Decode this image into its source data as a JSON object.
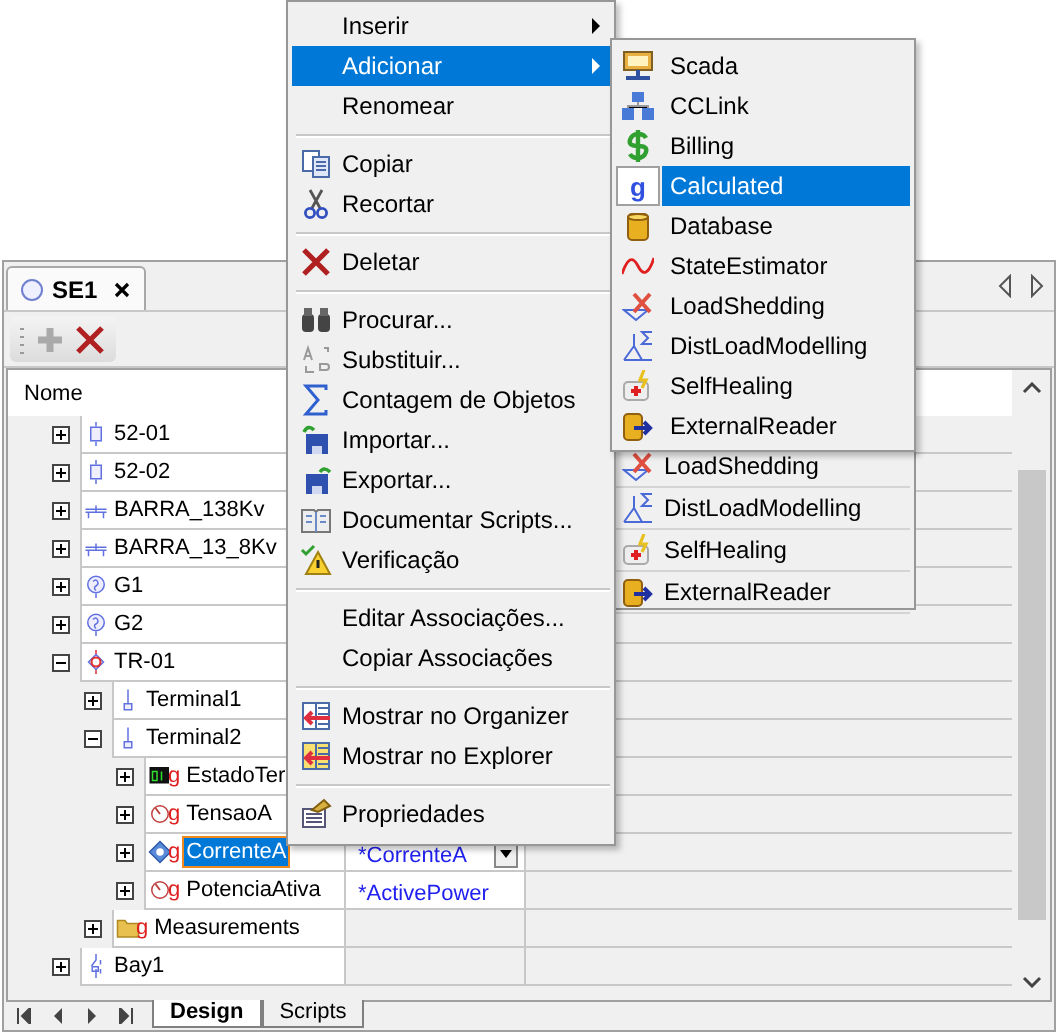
{
  "document_tab": {
    "label": "SE1",
    "selected": true
  },
  "tree": {
    "column_header": "Nome",
    "rows": [
      {
        "label": "52-01",
        "kind": "breaker",
        "expanded": false,
        "selected": false
      },
      {
        "label": "52-02",
        "kind": "breaker",
        "expanded": false,
        "selected": false
      },
      {
        "label": "BARRA_138Kv",
        "kind": "bus",
        "expanded": false,
        "selected": false
      },
      {
        "label": "BARRA_13_8Kv",
        "kind": "bus",
        "expanded": false,
        "selected": false
      },
      {
        "label": "G1",
        "kind": "generator",
        "expanded": false,
        "selected": false
      },
      {
        "label": "G2",
        "kind": "generator",
        "expanded": false,
        "selected": false
      },
      {
        "label": "TR-01",
        "kind": "transformer",
        "expanded": true,
        "selected": false,
        "children": [
          {
            "label": "Terminal1",
            "kind": "terminal",
            "expanded": false,
            "selected": false
          },
          {
            "label": "Terminal2",
            "kind": "terminal",
            "expanded": true,
            "selected": false,
            "children": [
              {
                "label": "EstadoTer",
                "kind": "digital",
                "badge": "g",
                "expanded": false,
                "selected": false
              },
              {
                "label": "TensaoA",
                "kind": "analog",
                "badge": "g",
                "expanded": false,
                "selected": false
              },
              {
                "label": "CorrenteA",
                "kind": "analog-set",
                "badge": "g",
                "expanded": false,
                "selected": true,
                "value": "*CorrenteA",
                "value_dropdown": true
              },
              {
                "label": "PotenciaAtiva",
                "kind": "analog",
                "badge": "g",
                "expanded": false,
                "selected": false,
                "value": "*ActivePower"
              }
            ]
          },
          {
            "label": "Measurements",
            "kind": "folder",
            "badge": "g",
            "expanded": false,
            "selected": false
          }
        ]
      },
      {
        "label": "Bay1",
        "kind": "bay",
        "expanded": false,
        "selected": false
      }
    ]
  },
  "sheet_tabs": [
    {
      "label": "Design",
      "selected": true
    },
    {
      "label": "Scripts",
      "selected": false
    }
  ],
  "context_menu": {
    "groups": [
      [
        {
          "label": "Inserir",
          "kind": "none",
          "submenu": true,
          "selected": false
        },
        {
          "label": "Adicionar",
          "kind": "none",
          "submenu": true,
          "selected": true
        },
        {
          "label": "Renomear",
          "kind": "none",
          "submenu": false,
          "selected": false
        }
      ],
      [
        {
          "label": "Copiar",
          "kind": "copy",
          "submenu": false,
          "selected": false
        },
        {
          "label": "Recortar",
          "kind": "cut",
          "submenu": false,
          "selected": false
        }
      ],
      [
        {
          "label": "Deletar",
          "kind": "delete",
          "submenu": false,
          "selected": false
        }
      ],
      [
        {
          "label": "Procurar...",
          "kind": "find",
          "submenu": false,
          "selected": false
        },
        {
          "label": "Substituir...",
          "kind": "replace",
          "submenu": false,
          "selected": false
        },
        {
          "label": "Contagem de Objetos",
          "kind": "sum",
          "submenu": false,
          "selected": false
        },
        {
          "label": "Importar...",
          "kind": "import",
          "submenu": false,
          "selected": false
        },
        {
          "label": "Exportar...",
          "kind": "export",
          "submenu": false,
          "selected": false
        },
        {
          "label": "Documentar Scripts...",
          "kind": "book",
          "submenu": false,
          "selected": false
        },
        {
          "label": "Verificação",
          "kind": "warning",
          "submenu": false,
          "selected": false
        }
      ],
      [
        {
          "label": "Editar Associações...",
          "kind": "none",
          "submenu": false,
          "selected": false
        },
        {
          "label": "Copiar Associações",
          "kind": "none",
          "submenu": false,
          "selected": false
        }
      ],
      [
        {
          "label": "Mostrar no Organizer",
          "kind": "show",
          "submenu": false,
          "selected": false
        },
        {
          "label": "Mostrar no Explorer",
          "kind": "show-star",
          "submenu": false,
          "selected": false
        }
      ],
      [
        {
          "label": "Propriedades",
          "kind": "properties",
          "submenu": false,
          "selected": false
        }
      ]
    ]
  },
  "submenu": {
    "items": [
      {
        "label": "Scada",
        "kind": "scada",
        "selected": false
      },
      {
        "label": "CCLink",
        "kind": "cclink",
        "selected": false
      },
      {
        "label": "Billing",
        "kind": "billing",
        "selected": false
      },
      {
        "label": "Calculated",
        "kind": "calculated",
        "glyph": "g",
        "selected": true
      },
      {
        "label": "Database",
        "kind": "database",
        "selected": false
      },
      {
        "label": "StateEstimator",
        "kind": "estimator",
        "selected": false
      },
      {
        "label": "LoadShedding",
        "kind": "shedding",
        "selected": false
      },
      {
        "label": "DistLoadModelling",
        "kind": "distload",
        "selected": false
      },
      {
        "label": "SelfHealing",
        "kind": "healing",
        "selected": false
      },
      {
        "label": "ExternalReader",
        "kind": "reader",
        "selected": false
      }
    ]
  },
  "submenu_remnant": {
    "items": [
      {
        "label": "LoadShedding",
        "kind": "shedding"
      },
      {
        "label": "DistLoadModelling",
        "kind": "distload"
      },
      {
        "label": "SelfHealing",
        "kind": "healing"
      },
      {
        "label": "ExternalReader",
        "kind": "reader"
      }
    ]
  }
}
